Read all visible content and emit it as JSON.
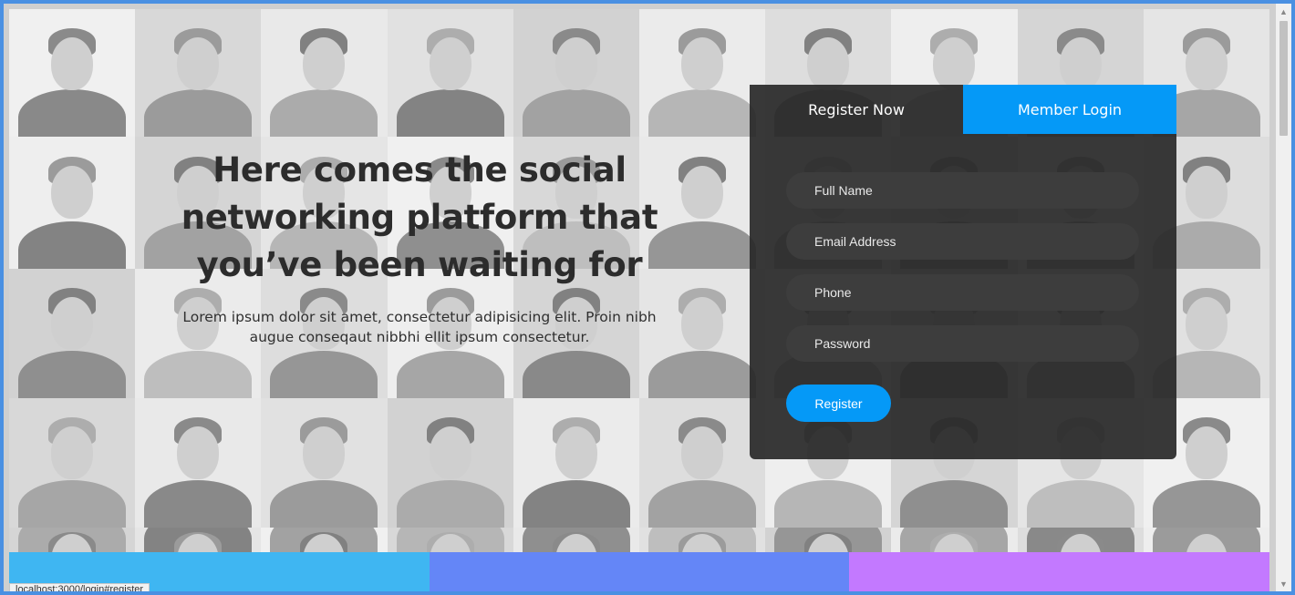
{
  "hero": {
    "title": "Here comes the social networking platform that you’ve been waiting for",
    "subtitle": "Lorem ipsum dolor sit amet, consectetur adipisicing elit. Proin nibh augue conseqaut nibbhi ellit ipsum consectetur."
  },
  "auth_panel": {
    "tabs": [
      {
        "label": "Register Now",
        "active": true
      },
      {
        "label": "Member Login",
        "active": false
      }
    ],
    "fields": [
      {
        "placeholder": "Full Name",
        "value": ""
      },
      {
        "placeholder": "Email Address",
        "value": ""
      },
      {
        "placeholder": "Phone",
        "value": ""
      },
      {
        "placeholder": "Password",
        "value": ""
      }
    ],
    "submit_label": "Register"
  },
  "status_bar": {
    "url": "localhost:3000/login#register"
  },
  "colors": {
    "accent": "#0599f7",
    "bottom_bar": [
      "#3fb6f2",
      "#6486f7",
      "#c379ff"
    ]
  }
}
